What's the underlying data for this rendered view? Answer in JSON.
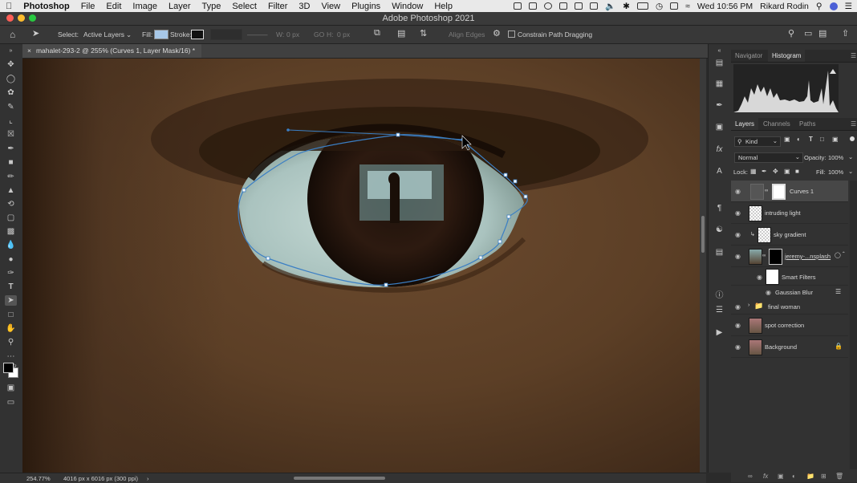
{
  "menubar": {
    "app": "Photoshop",
    "items": [
      "File",
      "Edit",
      "Image",
      "Layer",
      "Type",
      "Select",
      "Filter",
      "3D",
      "View",
      "Plugins",
      "Window",
      "Help"
    ],
    "datetime": "Wed 10:56 PM",
    "user": "Rikard Rodin"
  },
  "window": {
    "title": "Adobe Photoshop 2021"
  },
  "options": {
    "select_label": "Select:",
    "select_value": "Active Layers",
    "fill_label": "Fill:",
    "stroke_label": "Stroke:",
    "w_label": "W:",
    "w_value": "0 px",
    "h_label": "H:",
    "h_value": "0 px",
    "align_edges": "Align Edges",
    "constrain": "Constrain Path Dragging",
    "fill_color": "#a8c8e8"
  },
  "document": {
    "tab_title": "mahalet-293-2 @ 255% (Curves 1, Layer Mask/16) *",
    "zoom": "254.77%",
    "doc_info": "4016 px x 6016 px (300 ppi)"
  },
  "panels": {
    "top_tabs": [
      "Navigator",
      "Histogram"
    ],
    "layers_tabs": [
      "Layers",
      "Channels",
      "Paths"
    ],
    "filter_kind": "Kind",
    "blend_mode": "Normal",
    "opacity_label": "Opacity:",
    "opacity_value": "100%",
    "lock_label": "Lock:",
    "fill_label": "Fill:",
    "fill_value": "100%"
  },
  "layers": [
    {
      "name": "Curves 1",
      "selected": true
    },
    {
      "name": "intruding light"
    },
    {
      "name": "sky gradient"
    },
    {
      "name": "jeremy-...nsplash"
    },
    {
      "name": "Smart Filters"
    },
    {
      "name": "Gaussian Blur"
    },
    {
      "name": "final woman"
    },
    {
      "name": "spot correction"
    },
    {
      "name": "Background"
    }
  ],
  "colors": {
    "accent": "#2f7ac6",
    "path": "#3b7fc4"
  }
}
